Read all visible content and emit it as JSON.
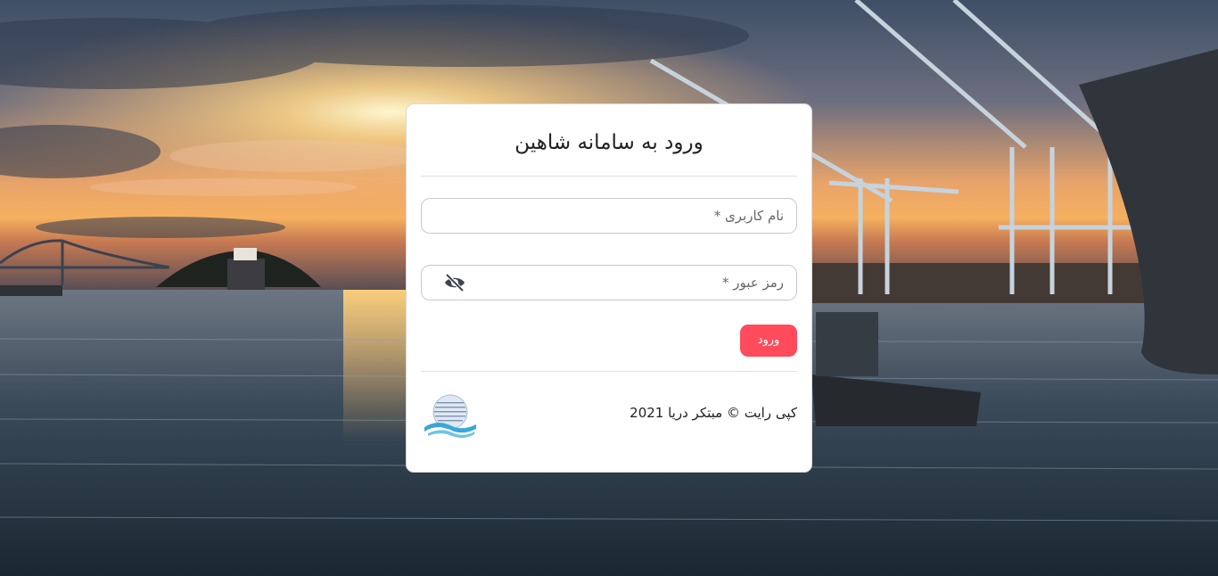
{
  "login": {
    "title": "ورود به سامانه شاهین",
    "username_label": "نام کاربری *",
    "password_label": "رمز عبور *",
    "submit_label": "ورود",
    "copyright": "کپی رایت © مبتکر دریا 2021"
  },
  "icons": {
    "password_toggle": "eye-slash-icon",
    "logo": "globe-wave-logo"
  },
  "colors": {
    "accent": "#ff4b5c"
  }
}
